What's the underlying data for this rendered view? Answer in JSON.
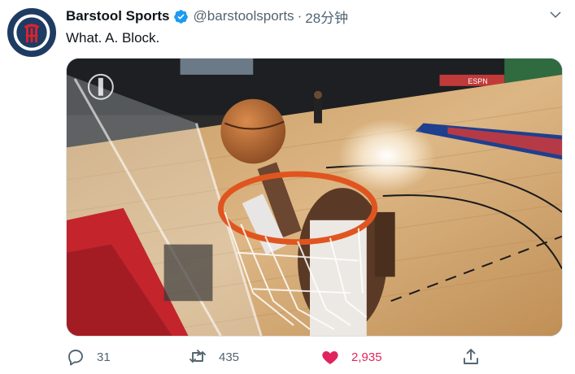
{
  "tweet": {
    "author": {
      "display_name": "Barstool Sports",
      "handle": "@barstoolsports",
      "verified": true,
      "avatar_icon": "barstool-logo-icon"
    },
    "separator": "·",
    "timestamp": "28分钟",
    "text": "What. A. Block.",
    "media": {
      "type": "video-still",
      "scene_labels": [
        "ESPN"
      ]
    },
    "stats": {
      "replies": "31",
      "retweets": "435",
      "likes": "2,935"
    },
    "liked": true
  },
  "icons": {
    "reply": "reply-icon",
    "retweet": "retweet-icon",
    "like": "heart-icon",
    "share": "share-icon",
    "menu": "chevron-down-icon",
    "verified": "verified-badge-icon"
  },
  "colors": {
    "text_primary": "#0f1419",
    "text_secondary": "#536471",
    "like_active": "#e0245e",
    "verified": "#1d9bf0"
  }
}
